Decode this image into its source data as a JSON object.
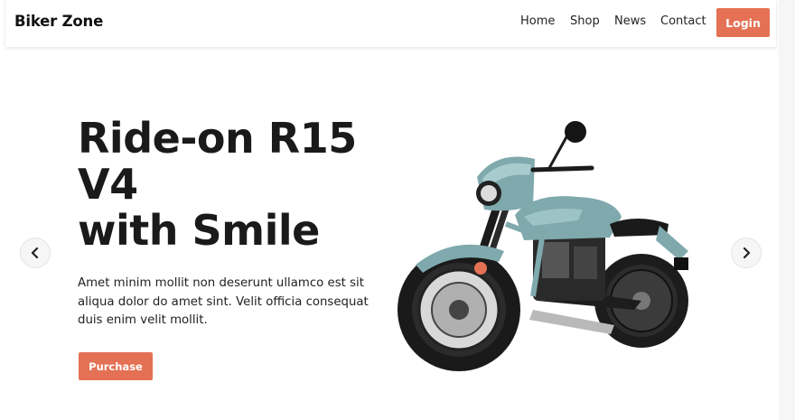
{
  "header": {
    "brand": "Biker Zone",
    "nav": [
      "Home",
      "Shop",
      "News",
      "Contact"
    ],
    "login_label": "Login"
  },
  "hero": {
    "title_lines": [
      "Ride-on R15",
      "V4",
      "with Smile"
    ],
    "description_lines": [
      "Amet minim mollit non deserunt ullamco est sit",
      "aliqua dolor do amet sint. Velit officia consequat",
      "duis enim velit mollit."
    ],
    "purchase_label": "Purchase"
  },
  "carousel": {
    "prev_icon": "chevron-left-icon",
    "next_icon": "chevron-right-icon"
  },
  "colors": {
    "accent": "#e57155",
    "text": "#1a1a1a",
    "bike_body": "#7fa9ad"
  }
}
